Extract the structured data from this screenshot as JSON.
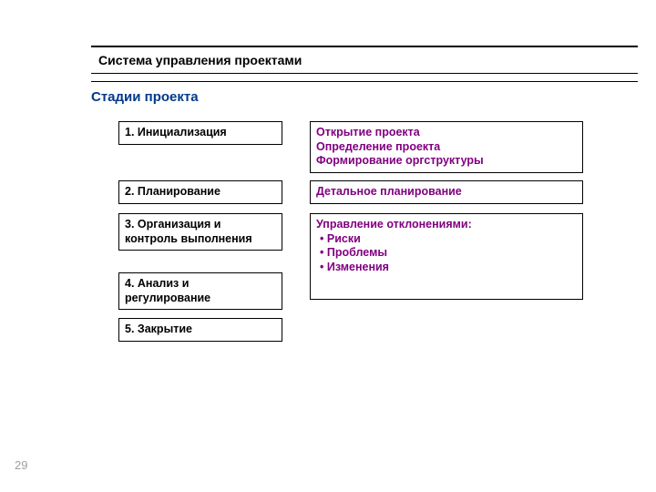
{
  "header": "Система управления проектами",
  "subheader": "Стадии проекта",
  "stages": {
    "s1": "1. Инициализация",
    "s2": "2. Планирование",
    "s3": "3. Организация и контроль выполнения",
    "s4": "4. Анализ и регулирование",
    "s5": "5. Закрытие"
  },
  "desc1": {
    "l1": "Открытие проекта",
    "l2": "Определение проекта",
    "l3": "Формирование оргструктуры"
  },
  "desc2": "Детальное планирование",
  "desc3": {
    "title": "Управление отклонениями:",
    "b1": "Риски",
    "b2": "Проблемы",
    "b3": "Изменения"
  },
  "pageNumber": "29"
}
